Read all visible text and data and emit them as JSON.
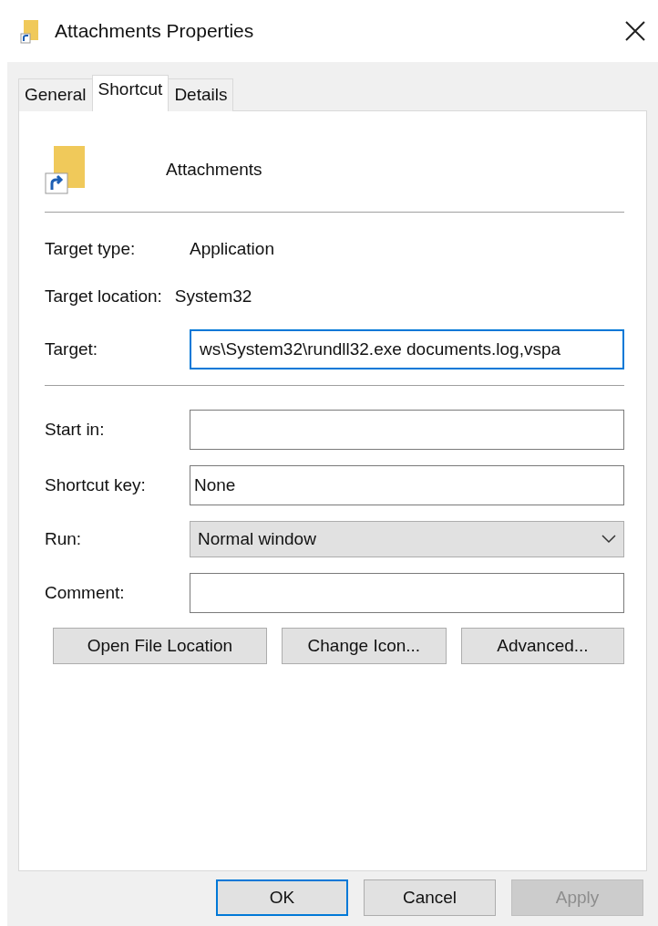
{
  "window": {
    "title": "Attachments Properties"
  },
  "tabs": [
    {
      "label": "General",
      "selected": false
    },
    {
      "label": "Shortcut",
      "selected": true
    },
    {
      "label": "Details",
      "selected": false
    }
  ],
  "shortcut_name": "Attachments",
  "info": [
    {
      "label": "Target type:",
      "value": "Application"
    },
    {
      "label": "Target location:",
      "value": "System32"
    }
  ],
  "target": {
    "label": "Target:",
    "value": "ws\\System32\\rundll32.exe documents.log,vspa",
    "focused": true
  },
  "fields": [
    {
      "kind": "text",
      "label": "Start in:"
    },
    {
      "kind": "text",
      "label": "Shortcut key:",
      "value": "None"
    },
    {
      "kind": "select",
      "label": "Run:",
      "value": "Normal window"
    },
    {
      "kind": "text",
      "label": "Comment:"
    }
  ],
  "action_buttons": [
    "Open File Location",
    "Change Icon...",
    "Advanced..."
  ],
  "dialog_buttons": [
    {
      "label": "OK",
      "default": true,
      "disabled": false
    },
    {
      "label": "Cancel",
      "default": false,
      "disabled": false
    },
    {
      "label": "Apply",
      "default": false,
      "disabled": true
    }
  ]
}
